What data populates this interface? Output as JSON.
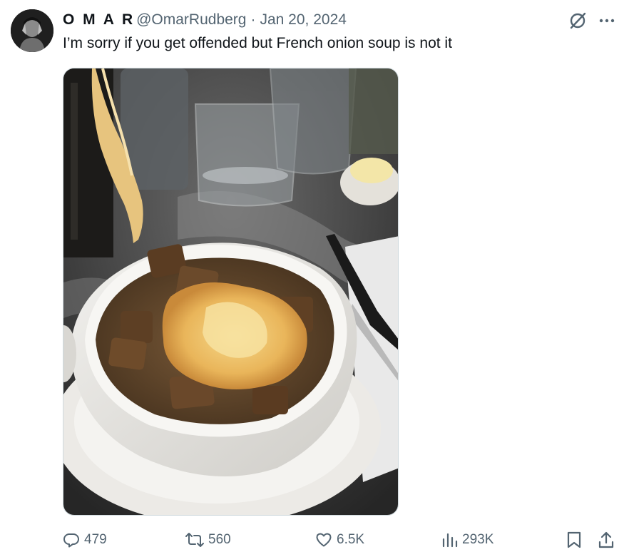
{
  "author": {
    "display_name": "O M A R",
    "handle": "@OmarRudberg",
    "separator": "·",
    "date": "Jan 20, 2024"
  },
  "tweet": {
    "text": "I’m sorry if you get offended but French onion soup is not it"
  },
  "icons": {
    "grok": "grok-icon",
    "more": "more-icon",
    "reply": "reply-icon",
    "retweet": "retweet-icon",
    "like": "heart-icon",
    "views": "views-icon",
    "bookmark": "bookmark-icon",
    "share": "share-icon"
  },
  "stats": {
    "replies": "479",
    "retweets": "560",
    "likes": "6.5K",
    "views": "293K"
  },
  "colors": {
    "text": "#0f1419",
    "secondary": "#536471",
    "border": "#cfd9de"
  }
}
